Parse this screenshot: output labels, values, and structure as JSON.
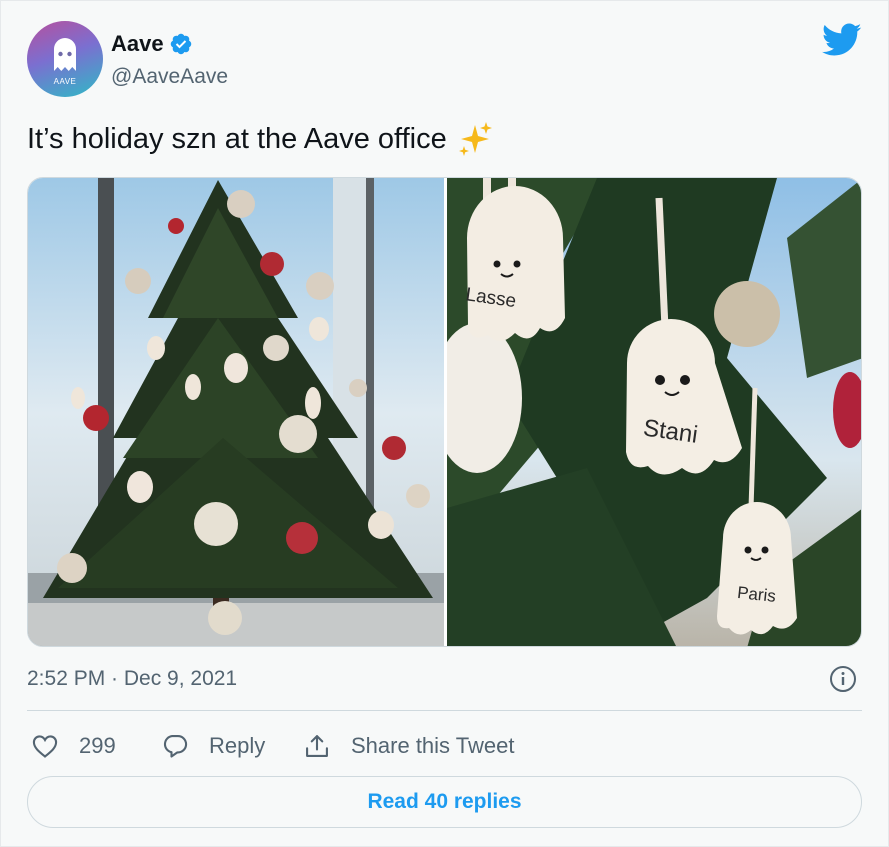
{
  "author": {
    "name": "Aave",
    "handle": "@AaveAave",
    "avatar_text": "AAVE",
    "verified_icon": "verified-badge-icon"
  },
  "tweet": {
    "text": "It’s holiday szn at the Aave office",
    "emoji": "sparkles-icon",
    "timestamp": "2:52 PM · Dec 9, 2021"
  },
  "media": {
    "right_ornament_names": [
      "Lasse",
      "Stani",
      "Paris"
    ]
  },
  "actions": {
    "like_count": "299",
    "reply_label": "Reply",
    "share_label": "Share this Tweet"
  },
  "read_replies": "Read 40 replies",
  "colors": {
    "accent": "#1d9bf0",
    "text_secondary": "#536471",
    "border": "#cfd9de",
    "background": "#f7f9f9"
  }
}
